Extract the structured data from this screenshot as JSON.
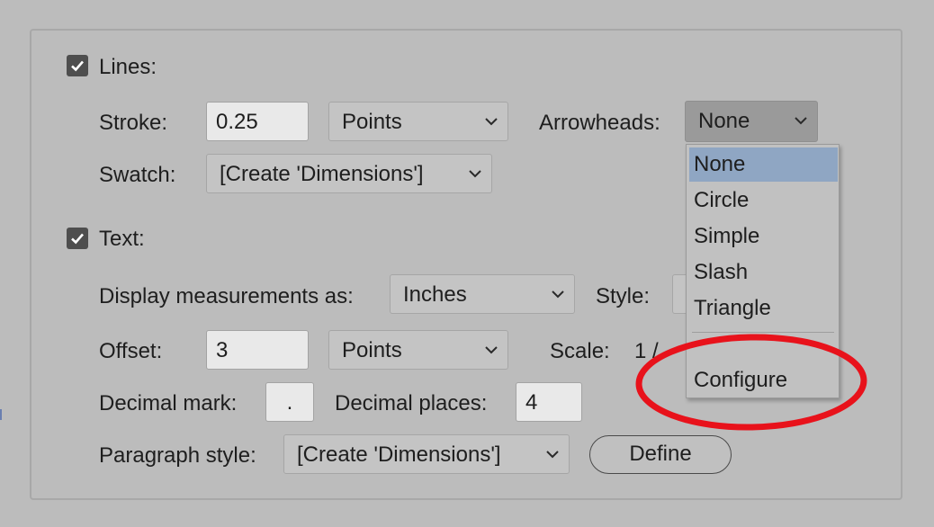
{
  "lines": {
    "checkbox_label": "Lines:",
    "checked": true,
    "stroke_label": "Stroke:",
    "stroke_value": "0.25",
    "stroke_unit": "Points",
    "arrowheads_label": "Arrowheads:",
    "arrowheads_value": "None",
    "swatch_label": "Swatch:",
    "swatch_value": "[Create 'Dimensions']"
  },
  "text": {
    "checkbox_label": "Text:",
    "checked": true,
    "display_label": "Display measurements as:",
    "display_value": "Inches",
    "style_label": "Style:",
    "offset_label": "Offset:",
    "offset_value": "3",
    "offset_unit": "Points",
    "scale_label": "Scale:",
    "scale_value": "1 /",
    "decimal_mark_label": "Decimal mark:",
    "decimal_mark_value": ".",
    "decimal_places_label": "Decimal places:",
    "decimal_places_value": "4",
    "paragraph_style_label": "Paragraph style:",
    "paragraph_style_value": "[Create 'Dimensions']",
    "define_button": "Define"
  },
  "arrowheads_menu": {
    "options": [
      "None",
      "Circle",
      "Simple",
      "Slash",
      "Triangle"
    ],
    "selected": "None",
    "configure": "Configure"
  },
  "colors": {
    "background": "#bcbcbc",
    "highlight": "#8fa6c3",
    "annotation": "#e8121b"
  }
}
